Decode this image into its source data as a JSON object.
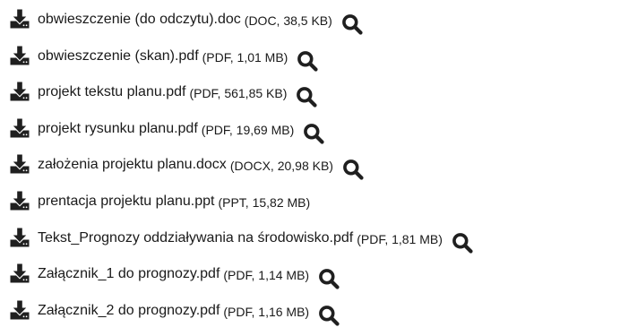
{
  "colors": {
    "icon": "#1f1f1f",
    "text": "#1a1a1a"
  },
  "icons": {
    "download": "download-icon",
    "preview": "search-icon"
  },
  "files": [
    {
      "name": "obwieszczenie (do odczytu).doc",
      "meta": "(DOC, 38,5 KB)",
      "has_preview": true
    },
    {
      "name": "obwieszczenie (skan).pdf",
      "meta": "(PDF, 1,01 MB)",
      "has_preview": true
    },
    {
      "name": "projekt tekstu planu.pdf",
      "meta": "(PDF, 561,85 KB)",
      "has_preview": true
    },
    {
      "name": "projekt rysunku planu.pdf",
      "meta": "(PDF, 19,69 MB)",
      "has_preview": true
    },
    {
      "name": "założenia projektu planu.docx",
      "meta": "(DOCX, 20,98 KB)",
      "has_preview": true
    },
    {
      "name": "prentacja projektu planu.ppt",
      "meta": "(PPT, 15,82 MB)",
      "has_preview": false
    },
    {
      "name": "Tekst_Prognozy oddziaływania na środowisko.pdf",
      "meta": "(PDF, 1,81 MB)",
      "has_preview": true
    },
    {
      "name": "Załącznik_1 do prognozy.pdf",
      "meta": "(PDF, 1,14 MB)",
      "has_preview": true
    },
    {
      "name": "Załącznik_2 do prognozy.pdf",
      "meta": "(PDF, 1,16 MB)",
      "has_preview": true
    }
  ]
}
